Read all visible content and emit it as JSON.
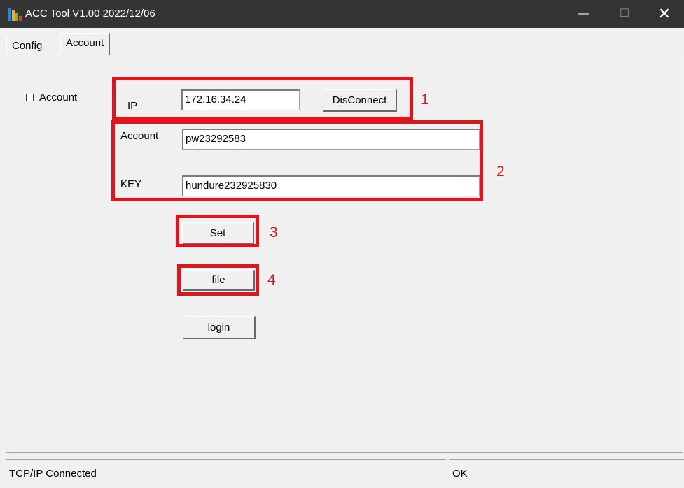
{
  "window": {
    "title": "ACC Tool V1.00  2022/12/06",
    "minimize": "—",
    "maximize": "☐",
    "close": "✕"
  },
  "tabs": [
    {
      "label": "Config"
    },
    {
      "label": "Account",
      "selected": true
    }
  ],
  "account_checkbox": {
    "label": "Account",
    "checked": false
  },
  "ip": {
    "label": "IP",
    "value": "172.16.34.24"
  },
  "disconnect_button": {
    "label": "DisConnect"
  },
  "account_field": {
    "label": "Account",
    "value": "pw23292583"
  },
  "key_field": {
    "label": "KEY",
    "value": "hundure232925830"
  },
  "set_button": {
    "label": "Set"
  },
  "file_button": {
    "label": "file"
  },
  "login_button": {
    "label": "login"
  },
  "annotations": [
    "1",
    "2",
    "3",
    "4"
  ],
  "annotation_color": "#e3131b",
  "status": {
    "left": "TCP/IP Connected",
    "right": "OK"
  }
}
